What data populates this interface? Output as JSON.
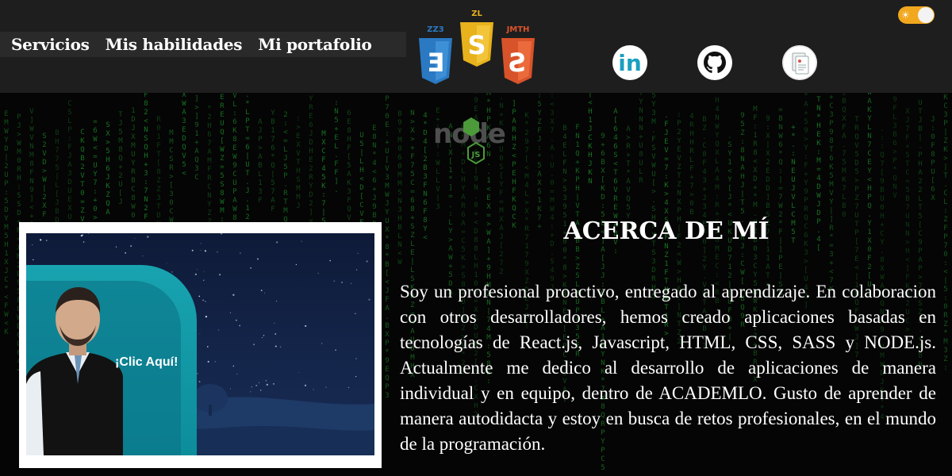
{
  "nav": {
    "items": [
      "Servicios",
      "Mis habilidades",
      "Mi portafolio"
    ]
  },
  "tech_logos": {
    "css_label": "ZZ3",
    "js_label": "ZL",
    "html_label": "JMTH",
    "js_glyph": "S",
    "css_glyph": "Ǝ",
    "html_glyph": "Ƨ",
    "node": "node",
    "node_badge": "JS"
  },
  "social": [
    {
      "name": "linkedin",
      "icon": "linkedin-icon",
      "glyph": "in"
    },
    {
      "name": "github",
      "icon": "github-icon"
    },
    {
      "name": "cv",
      "icon": "document-icon"
    }
  ],
  "theme_toggle": {
    "state": "on",
    "icon": "sun-icon"
  },
  "video": {
    "cta": "¡Clic Aquí!"
  },
  "about": {
    "title": "ACERCA DE MÍ",
    "text": "Soy un profesional proactivo, entregado al aprendizaje. En colaboracion con otros desarrolladores, hemos creado aplicaciones basadas en tecnologías de React.js, Javascript, HTML, CSS, SASS y NODE.js. Actualmente me dedico al desarrollo de aplicaciones de manera individual y en equipo, dentro de ACADEMLO. Gusto de aprender de manera autodidacta y estoy en busca de retos profesionales, en el mundo de la programación."
  },
  "colors": {
    "header_bg": "#1e1e1e",
    "matrix_green": "#1d8a2a",
    "toggle_accent": "#f2a81e",
    "teal": "#18a3b0",
    "css_blue": "#2a79c2",
    "js_yellow": "#e8b21d",
    "html_orange": "#d9532a"
  }
}
